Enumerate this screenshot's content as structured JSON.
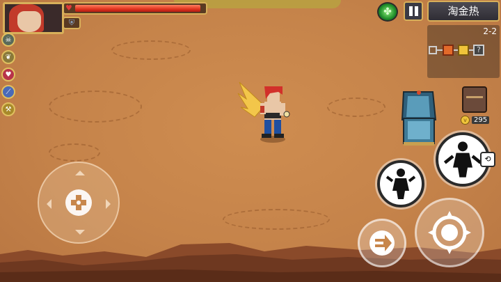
{
  "hud": {
    "stage_label": "2-2",
    "mode_label": "淘金热",
    "coins": "295",
    "hp_fraction": 0.98
  },
  "buffs": [
    {
      "icon": "skull-icon",
      "color": "#5a6a5a"
    },
    {
      "icon": "leaf-icon",
      "color": "#8a7a3a"
    },
    {
      "icon": "heart-icon",
      "color": "#b8344a"
    },
    {
      "icon": "sword-icon",
      "color": "#4a6ab8"
    },
    {
      "icon": "axe-icon",
      "color": "#a88a2a"
    }
  ],
  "minimap": {
    "rooms": [
      "empty-room",
      "shop-room",
      "chest-room",
      "unknown-room"
    ],
    "unknown_symbol": "?"
  },
  "colors": {
    "ground": "#c8864a",
    "frame_gold": "#d8b05a",
    "hp_red": "#e1341f",
    "coin_gold": "#f0c43a"
  }
}
